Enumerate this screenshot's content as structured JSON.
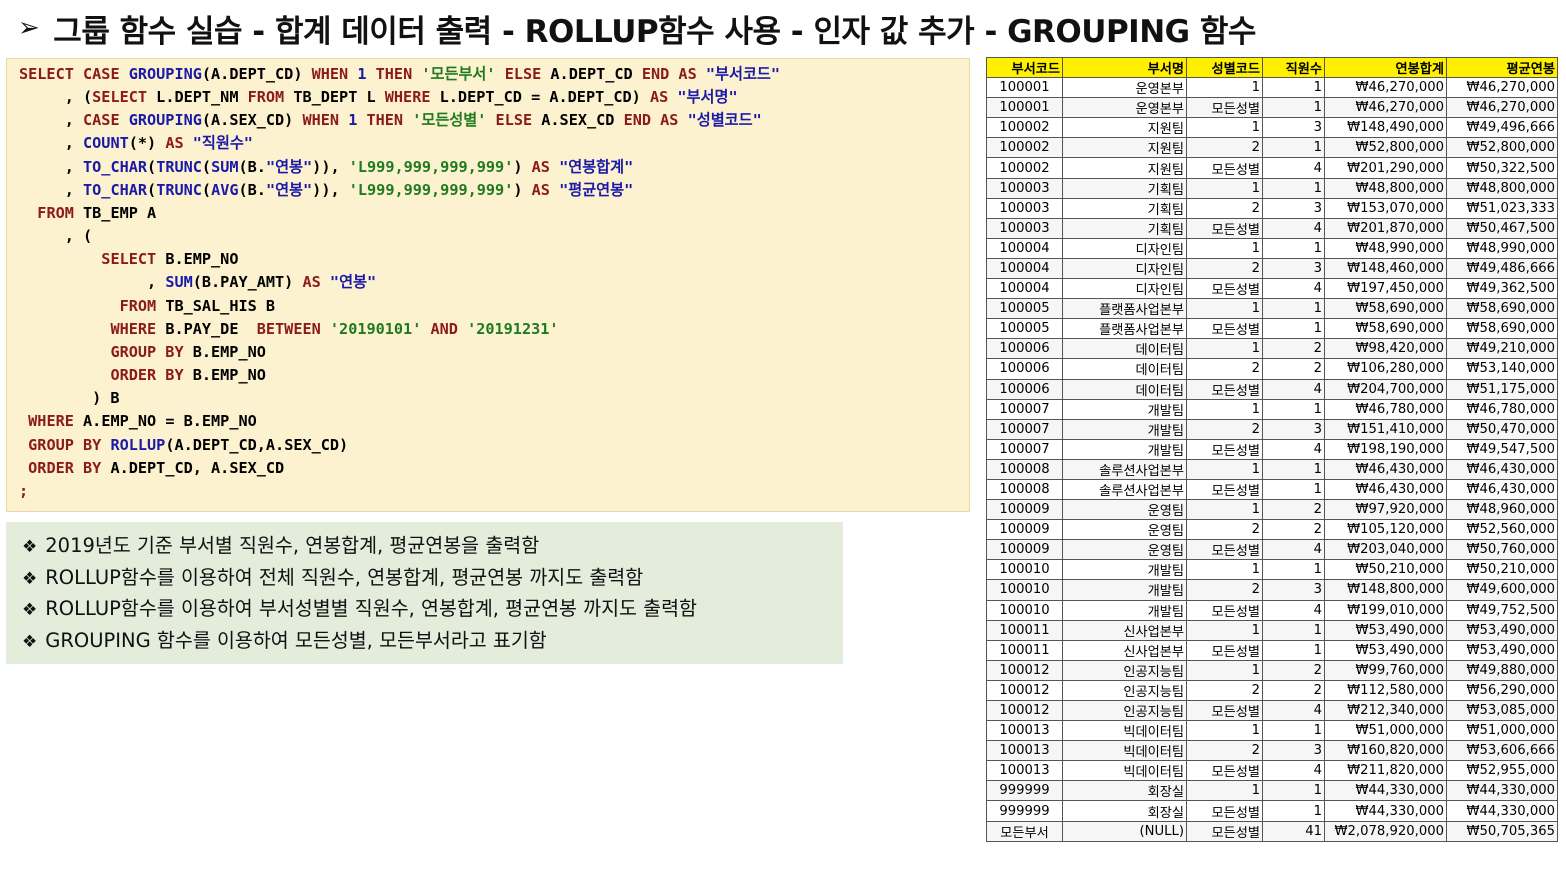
{
  "title": {
    "arrow": "➢",
    "text": "그룹 함수 실습 - 합계 데이터 출력 - ROLLUP함수 사용 - 인자 값 추가 - GROUPING 함수"
  },
  "notes": [
    {
      "bullet": "❖",
      "text": "2019년도 기준 부서별 직원수, 연봉합계, 평균연봉을 출력함"
    },
    {
      "bullet": "❖",
      "text": "ROLLUP함수를 이용하여 전체 직원수, 연봉합계, 평균연봉 까지도 출력함"
    },
    {
      "bullet": "❖",
      "text": "ROLLUP함수를 이용하여 부서성별별 직원수, 연봉합계, 평균연봉 까지도 출력함"
    },
    {
      "bullet": "❖",
      "text": "GROUPING 함수를 이용하여 모든성별, 모든부서라고 표기함"
    }
  ],
  "table": {
    "headers": [
      "부서코드",
      "부서명",
      "성별코드",
      "직원수",
      "연봉합계",
      "평균연봉"
    ],
    "rows": [
      [
        "100001",
        "운영본부",
        "1",
        "1",
        "₩46,270,000",
        "₩46,270,000"
      ],
      [
        "100001",
        "운영본부",
        "모든성별",
        "1",
        "₩46,270,000",
        "₩46,270,000"
      ],
      [
        "100002",
        "지원팀",
        "1",
        "3",
        "₩148,490,000",
        "₩49,496,666"
      ],
      [
        "100002",
        "지원팀",
        "2",
        "1",
        "₩52,800,000",
        "₩52,800,000"
      ],
      [
        "100002",
        "지원팀",
        "모든성별",
        "4",
        "₩201,290,000",
        "₩50,322,500"
      ],
      [
        "100003",
        "기획팀",
        "1",
        "1",
        "₩48,800,000",
        "₩48,800,000"
      ],
      [
        "100003",
        "기획팀",
        "2",
        "3",
        "₩153,070,000",
        "₩51,023,333"
      ],
      [
        "100003",
        "기획팀",
        "모든성별",
        "4",
        "₩201,870,000",
        "₩50,467,500"
      ],
      [
        "100004",
        "디자인팀",
        "1",
        "1",
        "₩48,990,000",
        "₩48,990,000"
      ],
      [
        "100004",
        "디자인팀",
        "2",
        "3",
        "₩148,460,000",
        "₩49,486,666"
      ],
      [
        "100004",
        "디자인팀",
        "모든성별",
        "4",
        "₩197,450,000",
        "₩49,362,500"
      ],
      [
        "100005",
        "플랫폼사업본부",
        "1",
        "1",
        "₩58,690,000",
        "₩58,690,000"
      ],
      [
        "100005",
        "플랫폼사업본부",
        "모든성별",
        "1",
        "₩58,690,000",
        "₩58,690,000"
      ],
      [
        "100006",
        "데이터팀",
        "1",
        "2",
        "₩98,420,000",
        "₩49,210,000"
      ],
      [
        "100006",
        "데이터팀",
        "2",
        "2",
        "₩106,280,000",
        "₩53,140,000"
      ],
      [
        "100006",
        "데이터팀",
        "모든성별",
        "4",
        "₩204,700,000",
        "₩51,175,000"
      ],
      [
        "100007",
        "개발팀",
        "1",
        "1",
        "₩46,780,000",
        "₩46,780,000"
      ],
      [
        "100007",
        "개발팀",
        "2",
        "3",
        "₩151,410,000",
        "₩50,470,000"
      ],
      [
        "100007",
        "개발팀",
        "모든성별",
        "4",
        "₩198,190,000",
        "₩49,547,500"
      ],
      [
        "100008",
        "솔루션사업본부",
        "1",
        "1",
        "₩46,430,000",
        "₩46,430,000"
      ],
      [
        "100008",
        "솔루션사업본부",
        "모든성별",
        "1",
        "₩46,430,000",
        "₩46,430,000"
      ],
      [
        "100009",
        "운영팀",
        "1",
        "2",
        "₩97,920,000",
        "₩48,960,000"
      ],
      [
        "100009",
        "운영팀",
        "2",
        "2",
        "₩105,120,000",
        "₩52,560,000"
      ],
      [
        "100009",
        "운영팀",
        "모든성별",
        "4",
        "₩203,040,000",
        "₩50,760,000"
      ],
      [
        "100010",
        "개발팀",
        "1",
        "1",
        "₩50,210,000",
        "₩50,210,000"
      ],
      [
        "100010",
        "개발팀",
        "2",
        "3",
        "₩148,800,000",
        "₩49,600,000"
      ],
      [
        "100010",
        "개발팀",
        "모든성별",
        "4",
        "₩199,010,000",
        "₩49,752,500"
      ],
      [
        "100011",
        "신사업본부",
        "1",
        "1",
        "₩53,490,000",
        "₩53,490,000"
      ],
      [
        "100011",
        "신사업본부",
        "모든성별",
        "1",
        "₩53,490,000",
        "₩53,490,000"
      ],
      [
        "100012",
        "인공지능팀",
        "1",
        "2",
        "₩99,760,000",
        "₩49,880,000"
      ],
      [
        "100012",
        "인공지능팀",
        "2",
        "2",
        "₩112,580,000",
        "₩56,290,000"
      ],
      [
        "100012",
        "인공지능팀",
        "모든성별",
        "4",
        "₩212,340,000",
        "₩53,085,000"
      ],
      [
        "100013",
        "빅데이터팀",
        "1",
        "1",
        "₩51,000,000",
        "₩51,000,000"
      ],
      [
        "100013",
        "빅데이터팀",
        "2",
        "3",
        "₩160,820,000",
        "₩53,606,666"
      ],
      [
        "100013",
        "빅데이터팀",
        "모든성별",
        "4",
        "₩211,820,000",
        "₩52,955,000"
      ],
      [
        "999999",
        "회장실",
        "1",
        "1",
        "₩44,330,000",
        "₩44,330,000"
      ],
      [
        "999999",
        "회장실",
        "모든성별",
        "1",
        "₩44,330,000",
        "₩44,330,000"
      ],
      [
        "모든부서",
        "(NULL)",
        "모든성별",
        "41",
        "₩2,078,920,000",
        "₩50,705,365"
      ]
    ]
  },
  "code_lines": [
    [
      [
        "kw",
        "SELECT "
      ],
      [
        "kw",
        "CASE "
      ],
      [
        "fn",
        "GROUPING"
      ],
      [
        "t",
        "(A.DEPT_CD) "
      ],
      [
        "kw",
        "WHEN "
      ],
      [
        "num",
        "1 "
      ],
      [
        "kw",
        "THEN "
      ],
      [
        "str",
        "'모든부서' "
      ],
      [
        "kw",
        "ELSE "
      ],
      [
        "t",
        "A.DEPT_CD "
      ],
      [
        "kw",
        "END "
      ],
      [
        "kw",
        "AS "
      ],
      [
        "qid",
        "\"부서코드\""
      ]
    ],
    [
      [
        "t",
        "     , ("
      ],
      [
        "kw",
        "SELECT "
      ],
      [
        "t",
        "L.DEPT_NM "
      ],
      [
        "kw",
        "FROM "
      ],
      [
        "t",
        "TB_DEPT L "
      ],
      [
        "kw",
        "WHERE "
      ],
      [
        "t",
        "L.DEPT_CD = A.DEPT_CD) "
      ],
      [
        "kw",
        "AS "
      ],
      [
        "qid",
        "\"부서명\""
      ]
    ],
    [
      [
        "t",
        "     , "
      ],
      [
        "kw",
        "CASE "
      ],
      [
        "fn",
        "GROUPING"
      ],
      [
        "t",
        "(A.SEX_CD) "
      ],
      [
        "kw",
        "WHEN "
      ],
      [
        "num",
        "1 "
      ],
      [
        "kw",
        "THEN "
      ],
      [
        "str",
        "'모든성별' "
      ],
      [
        "kw",
        "ELSE "
      ],
      [
        "t",
        "A.SEX_CD "
      ],
      [
        "kw",
        "END "
      ],
      [
        "kw",
        "AS "
      ],
      [
        "qid",
        "\"성별코드\""
      ]
    ],
    [
      [
        "t",
        "     , "
      ],
      [
        "fn",
        "COUNT"
      ],
      [
        "t",
        "(*) "
      ],
      [
        "kw",
        "AS "
      ],
      [
        "qid",
        "\"직원수\""
      ]
    ],
    [
      [
        "t",
        "     , "
      ],
      [
        "fn",
        "TO_CHAR"
      ],
      [
        "t",
        "("
      ],
      [
        "fn",
        "TRUNC"
      ],
      [
        "t",
        "("
      ],
      [
        "fn",
        "SUM"
      ],
      [
        "t",
        "(B."
      ],
      [
        "qid",
        "\"연봉\""
      ],
      [
        "t",
        ")), "
      ],
      [
        "str",
        "'L999,999,999,999'"
      ],
      [
        "t",
        ") "
      ],
      [
        "kw",
        "AS "
      ],
      [
        "qid",
        "\"연봉합계\""
      ]
    ],
    [
      [
        "t",
        "     , "
      ],
      [
        "fn",
        "TO_CHAR"
      ],
      [
        "t",
        "("
      ],
      [
        "fn",
        "TRUNC"
      ],
      [
        "t",
        "("
      ],
      [
        "fn",
        "AVG"
      ],
      [
        "t",
        "(B."
      ],
      [
        "qid",
        "\"연봉\""
      ],
      [
        "t",
        ")), "
      ],
      [
        "str",
        "'L999,999,999,999'"
      ],
      [
        "t",
        ") "
      ],
      [
        "kw",
        "AS "
      ],
      [
        "qid",
        "\"평균연봉\""
      ]
    ],
    [
      [
        "t",
        "  "
      ],
      [
        "kw",
        "FROM "
      ],
      [
        "t",
        "TB_EMP A"
      ]
    ],
    [
      [
        "t",
        "     , ("
      ]
    ],
    [
      [
        "t",
        "         "
      ],
      [
        "kw",
        "SELECT "
      ],
      [
        "t",
        "B.EMP_NO"
      ]
    ],
    [
      [
        "t",
        "              , "
      ],
      [
        "fn",
        "SUM"
      ],
      [
        "t",
        "(B.PAY_AMT) "
      ],
      [
        "kw",
        "AS "
      ],
      [
        "qid",
        "\"연봉\""
      ]
    ],
    [
      [
        "t",
        "           "
      ],
      [
        "kw",
        "FROM "
      ],
      [
        "t",
        "TB_SAL_HIS B"
      ]
    ],
    [
      [
        "t",
        "          "
      ],
      [
        "kw",
        "WHERE "
      ],
      [
        "t",
        "B.PAY_DE  "
      ],
      [
        "kw",
        "BETWEEN "
      ],
      [
        "str",
        "'20190101' "
      ],
      [
        "kw",
        "AND "
      ],
      [
        "str",
        "'20191231'"
      ]
    ],
    [
      [
        "t",
        "          "
      ],
      [
        "kw",
        "GROUP BY "
      ],
      [
        "t",
        "B.EMP_NO"
      ]
    ],
    [
      [
        "t",
        "          "
      ],
      [
        "kw",
        "ORDER BY "
      ],
      [
        "t",
        "B.EMP_NO"
      ]
    ],
    [
      [
        "t",
        "        ) B"
      ]
    ],
    [
      [
        "t",
        " "
      ],
      [
        "kw",
        "WHERE "
      ],
      [
        "t",
        "A.EMP_NO = B.EMP_NO"
      ]
    ],
    [
      [
        "t",
        " "
      ],
      [
        "kw",
        "GROUP BY "
      ],
      [
        "fn",
        "ROLLUP"
      ],
      [
        "t",
        "(A.DEPT_CD,A.SEX_CD)"
      ]
    ],
    [
      [
        "t",
        " "
      ],
      [
        "kw",
        "ORDER BY "
      ],
      [
        "t",
        "A.DEPT_CD, A.SEX_CD"
      ]
    ],
    [
      [
        "kw",
        ";"
      ]
    ]
  ]
}
